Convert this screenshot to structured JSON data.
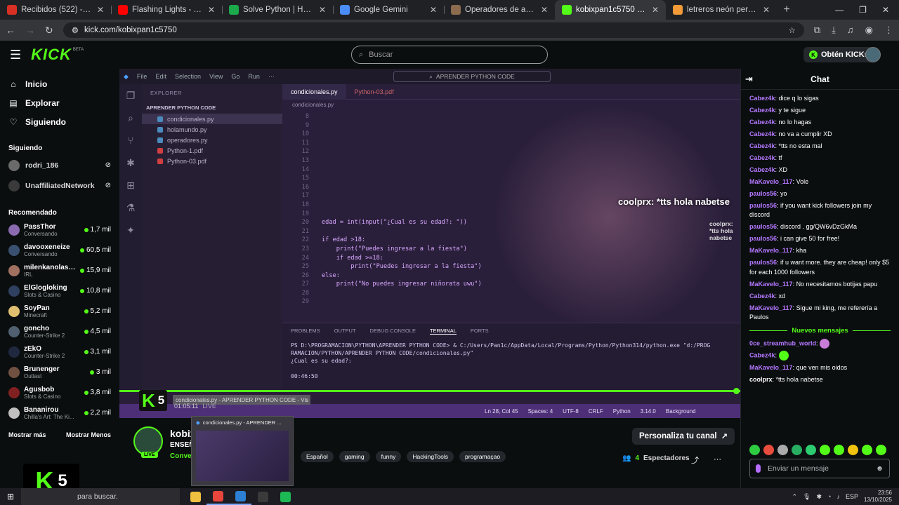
{
  "browser": {
    "tabs": [
      {
        "label": "Recibidos (522) - digpgod@gmail.com",
        "icon": "gmail-icon",
        "color": "#d93025",
        "active": false
      },
      {
        "label": "Flashing Lights - YouTube",
        "icon": "youtube-icon",
        "color": "#ff0000",
        "active": false
      },
      {
        "label": "Solve Python | HackerRank",
        "icon": "hackerrank-icon",
        "color": "#1ba94c",
        "active": false
      },
      {
        "label": "Google Gemini",
        "icon": "gemini-icon",
        "color": "#4b8df8",
        "active": false
      },
      {
        "label": "Operadores de asignación | Py",
        "icon": "docs-icon",
        "color": "#8c6b4f",
        "active": false
      },
      {
        "label": "kobixpan1c5750 Stream - Watch",
        "icon": "kick-icon",
        "color": "#53fc18",
        "active": true
      },
      {
        "label": "letreros neón personalizados le",
        "icon": "shop-icon",
        "color": "#f29b38",
        "active": false
      }
    ],
    "new_tab": "+",
    "url": "kick.com/kobixpan1c5750"
  },
  "header": {
    "logo": "KICK",
    "beta": "BETA",
    "search_placeholder": "Buscar",
    "get_kicks": "Obtén KICKs"
  },
  "sidebar": {
    "nav": [
      {
        "label": "Inicio",
        "icon": "home-icon",
        "glyph": "⌂"
      },
      {
        "label": "Explorar",
        "icon": "compass-icon",
        "glyph": "▤"
      },
      {
        "label": "Siguiendo",
        "icon": "heart-icon",
        "glyph": "♡"
      }
    ],
    "following_title": "Siguiendo",
    "following": [
      {
        "name": "rodri_186",
        "color": "#6a6a6a"
      },
      {
        "name": "UnaffiliatedNetwork",
        "color": "#3a3a3a"
      }
    ],
    "recommended_title": "Recomendado",
    "recommended": [
      {
        "name": "PassThor",
        "category": "Conversando",
        "viewers": "1,7 mil",
        "color": "#8a6ab0"
      },
      {
        "name": "davooxeneize",
        "category": "Conversando",
        "viewers": "60,5 mil",
        "color": "#3a5070"
      },
      {
        "name": "milenkanolasco",
        "category": "IRL",
        "viewers": "15,9 mil",
        "color": "#a07060"
      },
      {
        "name": "ElGlogloking",
        "category": "Slots & Casino",
        "viewers": "10,8 mil",
        "color": "#304060"
      },
      {
        "name": "SoyPan",
        "category": "Minecraft",
        "viewers": "5,2 mil",
        "color": "#e0c070"
      },
      {
        "name": "goncho",
        "category": "Counter-Strike 2",
        "viewers": "4,5 mil",
        "color": "#506070"
      },
      {
        "name": "zEkO",
        "category": "Counter-Strike 2",
        "viewers": "3,1 mil",
        "color": "#202840"
      },
      {
        "name": "Brunenger",
        "category": "Outlast",
        "viewers": "3 mil",
        "color": "#705040"
      },
      {
        "name": "Agusbob",
        "category": "Slots & Casino",
        "viewers": "3,8 mil",
        "color": "#802020"
      },
      {
        "name": "Bananirou",
        "category": "Chilla's Art: The Ki...",
        "viewers": "2,2 mil",
        "color": "#c0c0c0"
      }
    ],
    "show_more": "Mostrar más",
    "show_less": "Mostrar Menos",
    "kick_badge_number": "5"
  },
  "video": {
    "vscode": {
      "menu": [
        "File",
        "Edit",
        "Selection",
        "View",
        "Go",
        "Run",
        "···"
      ],
      "search": "APRENDER PYTHON CODE",
      "explorer_title": "EXPLORER",
      "project": "APRENDER PYTHON CODE",
      "files": [
        {
          "name": "condicionales.py",
          "color": "#4b8bbe",
          "selected": true
        },
        {
          "name": "holamundo.py",
          "color": "#4b8bbe",
          "selected": false
        },
        {
          "name": "operadores.py",
          "color": "#4b8bbe",
          "selected": false
        },
        {
          "name": "Python-1.pdf",
          "color": "#d04040",
          "selected": false
        },
        {
          "name": "Python-03.pdf",
          "color": "#d04040",
          "selected": false
        }
      ],
      "tabs": [
        "condicionales.py",
        "Python-03.pdf"
      ],
      "breadcrumb": "condicionales.py",
      "code": [
        {
          "n": "8",
          "t": ""
        },
        {
          "n": "9",
          "t": ""
        },
        {
          "n": "10",
          "t": ""
        },
        {
          "n": "11",
          "t": ""
        },
        {
          "n": "12",
          "t": ""
        },
        {
          "n": "13",
          "t": ""
        },
        {
          "n": "14",
          "t": ""
        },
        {
          "n": "15",
          "t": ""
        },
        {
          "n": "16",
          "t": ""
        },
        {
          "n": "17",
          "t": ""
        },
        {
          "n": "18",
          "t": ""
        },
        {
          "n": "19",
          "t": ""
        },
        {
          "n": "20",
          "t": "edad = int(input(\"¿Cual es su edad?: \"))"
        },
        {
          "n": "21",
          "t": ""
        },
        {
          "n": "22",
          "t": "if edad >18:"
        },
        {
          "n": "23",
          "t": "    print(\"Puedes ingresar a la fiesta\")"
        },
        {
          "n": "24",
          "t": "    if edad >=18:"
        },
        {
          "n": "25",
          "t": "        print(\"Puedes ingresar a la fiesta\")"
        },
        {
          "n": "26",
          "t": "else:"
        },
        {
          "n": "27",
          "t": "    print(\"No puedes ingresar niñorata uwu\")"
        },
        {
          "n": "28",
          "t": ""
        },
        {
          "n": "29",
          "t": ""
        }
      ],
      "panel_tabs": [
        "PROBLEMS",
        "OUTPUT",
        "DEBUG CONSOLE",
        "TERMINAL",
        "PORTS"
      ],
      "terminal": [
        "PS D:\\PROGRAMACION\\PYTHON\\APRENDER PYTHON CODE> & C:/Users/Pan1c/AppData/Local/Programs/Python/Python314/python.exe \"d:/PROG",
        "RAMACION/PYTHON/APRENDER PYTHON CODE/condicionales.py\"",
        "¿Cual es su edad?:",
        "",
        "   00:46:50"
      ],
      "status": [
        "Ln 28, Col 45",
        "Spaces: 4",
        "UTF-8",
        "CRLF",
        "Python",
        "3.14.0",
        "Background"
      ]
    },
    "tts_big": "coolprx: *tts hola nabetse",
    "tts_small": "coolprx: *tts hola nabetse",
    "window_tooltip": "condicionales.py - APRENDER PYTHON CODE - Vis",
    "time": "01:05:11",
    "live": "LIVE",
    "progress_fraction": 1.0
  },
  "stream": {
    "name": "kobixpan1c5750",
    "title": "ENSEÑ...",
    "category": "Conversando",
    "tags": [
      "Español",
      "gaming",
      "funny",
      "HackingTools",
      "programaçao"
    ],
    "live_badge": "LIVE",
    "customize": "Personaliza tu canal",
    "viewers_count": "4",
    "viewers_label": "Espectadores",
    "thumb_title": "condicionales.py - APRENDER ..."
  },
  "chat": {
    "title": "Chat",
    "messages": [
      {
        "user": "Cabez4k",
        "color": "#b478ff",
        "text": "dice q lo sigas"
      },
      {
        "user": "Cabez4k",
        "color": "#b478ff",
        "text": "y te sigue"
      },
      {
        "user": "Cabez4k",
        "color": "#b478ff",
        "text": "no lo hagas"
      },
      {
        "user": "Cabez4k",
        "color": "#b478ff",
        "text": "no va a cumplir XD"
      },
      {
        "user": "Cabez4k",
        "color": "#b478ff",
        "text": "*tts no esta mal"
      },
      {
        "user": "Cabez4k",
        "color": "#b478ff",
        "text": "tf"
      },
      {
        "user": "Cabez4k",
        "color": "#b478ff",
        "text": "XD"
      },
      {
        "user": "MaKavelo_117",
        "color": "#b478ff",
        "text": "Vole"
      },
      {
        "user": "paulos56",
        "color": "#b478ff",
        "text": "yo"
      },
      {
        "user": "paulos56",
        "color": "#b478ff",
        "text": "if you want kick followers join my discord"
      },
      {
        "user": "paulos56",
        "color": "#b478ff",
        "text": "discord . gg/QW6vDzGkMa"
      },
      {
        "user": "paulos56",
        "color": "#b478ff",
        "text": "i can give 50 for free!"
      },
      {
        "user": "MaKavelo_117",
        "color": "#b478ff",
        "text": "kha"
      },
      {
        "user": "paulos56",
        "color": "#b478ff",
        "text": "if u want more. they are cheap! only $5 for each 1000 followers"
      },
      {
        "user": "MaKavelo_117",
        "color": "#b478ff",
        "text": "No necesitamos botijas papu"
      },
      {
        "user": "Cabez4k",
        "color": "#b478ff",
        "text": "xd"
      },
      {
        "user": "MaKavelo_117",
        "color": "#b478ff",
        "text": "Sigue mi king, me referería a Paulos"
      }
    ],
    "new_messages": "Nuevos mensajes",
    "new": [
      {
        "user": "0ce_streamhub_world",
        "color": "#b478ff",
        "text": "",
        "emote": "#c97bd8"
      },
      {
        "user": "Cabez4k",
        "color": "#b478ff",
        "text": "",
        "emote": "#53fc18"
      },
      {
        "user": "MaKavelo_117",
        "color": "#b478ff",
        "text": "que ven mis oidos",
        "emote": ""
      },
      {
        "user": "coolprx",
        "color": "#ffffff",
        "text": "*tts hola nabetse",
        "emote": ""
      }
    ],
    "emote_colors": [
      "#2ecc40",
      "#e74c3c",
      "#aaaaaa",
      "#27ae60",
      "#2ecc71",
      "#53fc18",
      "#53fc18",
      "#f1c40f",
      "#53fc18",
      "#53fc18"
    ],
    "input_placeholder": "Enviar un mensaje"
  },
  "taskbar": {
    "search": "para buscar.",
    "apps": [
      {
        "name": "files-app",
        "color": "#f0c040"
      },
      {
        "name": "chrome-app",
        "color": "#e8453c"
      },
      {
        "name": "vscode-app",
        "color": "#2d7fd3"
      },
      {
        "name": "obs-app",
        "color": "#3a3a3a"
      },
      {
        "name": "spotify-app",
        "color": "#1db954"
      }
    ],
    "lang": "ESP",
    "time": "23:56",
    "date": "13/10/2025"
  }
}
